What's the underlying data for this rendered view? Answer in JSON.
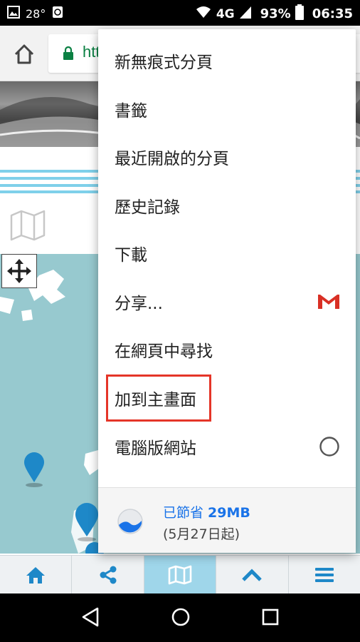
{
  "status_bar": {
    "temperature": "28°",
    "network": "4G",
    "battery": "93%",
    "time": "06:35"
  },
  "toolbar": {
    "url_partial": "htt"
  },
  "menu": {
    "items": [
      {
        "label": "新無痕式分頁"
      },
      {
        "label": "書籤"
      },
      {
        "label": "最近開啟的分頁"
      },
      {
        "label": "歷史記錄"
      },
      {
        "label": "下載"
      },
      {
        "label": "分享..."
      },
      {
        "label": "在網頁中尋找"
      },
      {
        "label": "加到主畫面"
      },
      {
        "label": "電腦版網站"
      }
    ],
    "data_saver": {
      "title_prefix": "已節省 ",
      "title_amount": "29MB",
      "subtitle": "(5月27日起)"
    }
  },
  "bottom_nav": {
    "active": "map",
    "items": [
      "home",
      "share",
      "map",
      "up",
      "menu"
    ]
  },
  "colors": {
    "accent": "#1a73e8",
    "nav_icon": "#1e88c8",
    "highlight_border": "#e53528",
    "map_water": "#97c9cf"
  }
}
